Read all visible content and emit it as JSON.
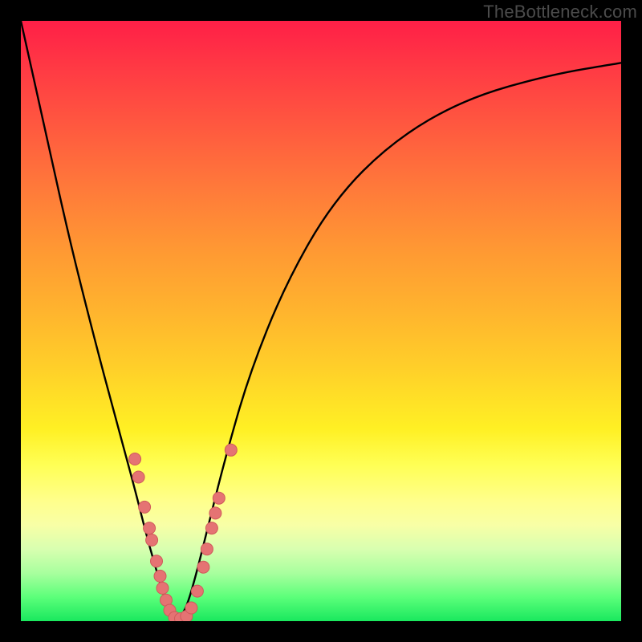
{
  "watermark": "TheBottleneck.com",
  "colors": {
    "frame": "#000000",
    "gradient_stops": [
      "#ff1f47",
      "#ff3a44",
      "#ff5a3f",
      "#ff7a3a",
      "#ff9833",
      "#ffb32e",
      "#ffd029",
      "#fff024",
      "#ffff55",
      "#ffff8c",
      "#f8ffa6",
      "#d8ffb0",
      "#a8ff9e",
      "#5cff7a",
      "#19e85e"
    ],
    "curve": "#000000",
    "dot_fill": "#e57373",
    "dot_stroke": "#cf5a5a"
  },
  "chart_data": {
    "type": "line",
    "title": "",
    "xlabel": "",
    "ylabel": "",
    "xlim": [
      0,
      100
    ],
    "ylim": [
      0,
      100
    ],
    "note": "No axis ticks or numeric labels are displayed; x and y values are estimated in percent of the plot area. y=0 is bottom (green), y=100 is top (red). The curve is a V-shaped bottleneck curve with minimum near x≈26.",
    "series": [
      {
        "name": "bottleneck-curve",
        "x": [
          0,
          4,
          8,
          12,
          16,
          19,
          21,
          23,
          24.5,
          26,
          27.5,
          29,
          31,
          34,
          38,
          44,
          52,
          62,
          74,
          88,
          100
        ],
        "y": [
          100,
          82,
          64,
          48,
          33,
          22,
          14,
          7,
          2,
          0,
          2,
          7,
          15,
          27,
          41,
          56,
          70,
          80,
          87,
          91,
          93
        ]
      }
    ],
    "scatter": {
      "name": "highlighted-points",
      "note": "Pink dot markers clustered near the minimum on both branches.",
      "points": [
        {
          "x": 19.0,
          "y": 27.0
        },
        {
          "x": 19.6,
          "y": 24.0
        },
        {
          "x": 20.6,
          "y": 19.0
        },
        {
          "x": 21.4,
          "y": 15.5
        },
        {
          "x": 21.8,
          "y": 13.5
        },
        {
          "x": 22.6,
          "y": 10.0
        },
        {
          "x": 23.2,
          "y": 7.5
        },
        {
          "x": 23.6,
          "y": 5.5
        },
        {
          "x": 24.2,
          "y": 3.5
        },
        {
          "x": 24.8,
          "y": 1.8
        },
        {
          "x": 25.6,
          "y": 0.6
        },
        {
          "x": 26.6,
          "y": 0.4
        },
        {
          "x": 27.6,
          "y": 0.8
        },
        {
          "x": 28.4,
          "y": 2.2
        },
        {
          "x": 29.4,
          "y": 5.0
        },
        {
          "x": 30.4,
          "y": 9.0
        },
        {
          "x": 31.0,
          "y": 12.0
        },
        {
          "x": 31.8,
          "y": 15.5
        },
        {
          "x": 32.4,
          "y": 18.0
        },
        {
          "x": 33.0,
          "y": 20.5
        },
        {
          "x": 35.0,
          "y": 28.5
        }
      ]
    }
  }
}
